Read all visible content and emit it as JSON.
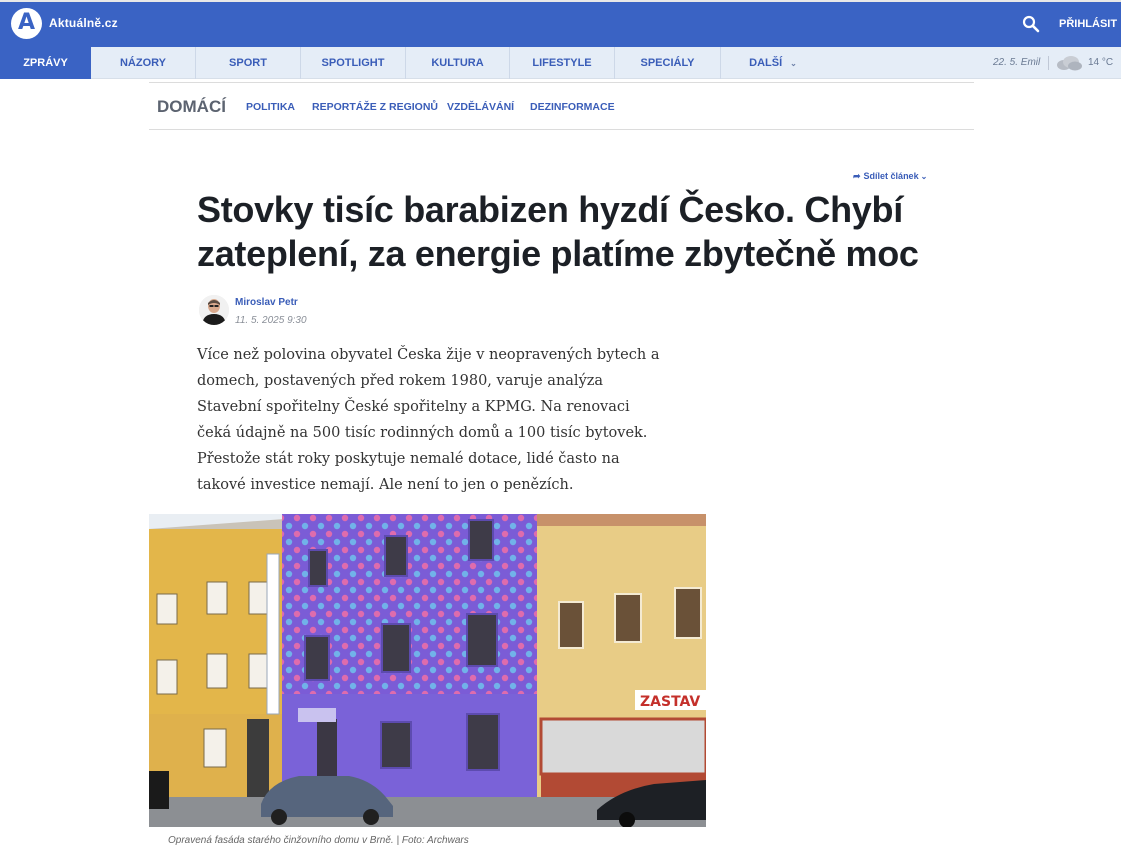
{
  "header": {
    "logo_letter": "A",
    "logo_text": "Aktuálně.cz",
    "login_label": "PŘIHLÁSIT",
    "search_icon": "search-icon",
    "brand_color": "#3a63c4"
  },
  "nav": {
    "items": [
      {
        "label": "ZPRÁVY",
        "active": true
      },
      {
        "label": "NÁZORY"
      },
      {
        "label": "SPORT"
      },
      {
        "label": "SPOTLIGHT"
      },
      {
        "label": "KULTURA"
      },
      {
        "label": "LIFESTYLE"
      },
      {
        "label": "SPECIÁLY"
      },
      {
        "label": "DALŠÍ"
      }
    ],
    "date": "22. 5. Emil",
    "temperature": "14 °C",
    "weather_icon": "cloud-icon"
  },
  "subnav": {
    "section": "DOMÁCÍ",
    "items": [
      "POLITIKA",
      "REPORTÁŽE Z REGIONŮ",
      "VZDĚLÁVÁNÍ",
      "DEZINFORMACE"
    ]
  },
  "article": {
    "share_label": "Sdílet článek",
    "headline_line1": "Stovky tisíc barabizen hyzdí Česko. Chybí",
    "headline_line2": "zateplení, za energie platíme zbytečně moc",
    "author": "Miroslav Petr",
    "published": "11. 5. 2025 9:30",
    "perex": "Více než polovina obyvatel Česka žije v neopravených bytech a domech, postavených před rokem 1980, varuje analýza Stavební spořitelny České spořitelny a KPMG. Na renovaci čeká údajně na 500 tisíc rodinných domů a 100 tisíc bytovek. Přestože stát roky poskytuje nemalé dotace, lidé často na takové investice nemají. Ale není to jen o penězích.",
    "photo_sign": "ZASTAV",
    "caption": "Opravená fasáda starého činžovního domu v Brně. | Foto: Archwars"
  }
}
